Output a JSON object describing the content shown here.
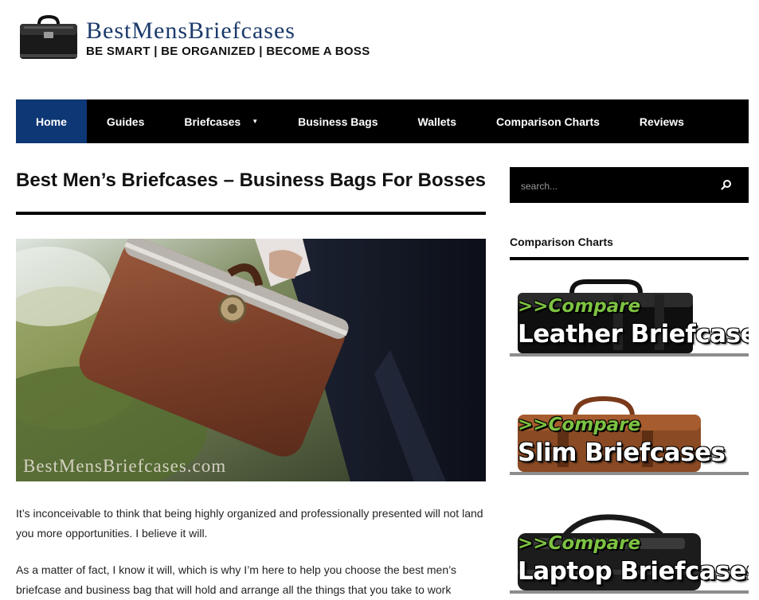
{
  "site": {
    "title": "BestMensBriefcases",
    "tagline": "BE SMART | BE ORGANIZED | BECOME A BOSS"
  },
  "nav": {
    "items": [
      {
        "label": "Home",
        "active": true
      },
      {
        "label": "Guides"
      },
      {
        "label": "Briefcases",
        "has_submenu": true
      },
      {
        "label": "Business Bags"
      },
      {
        "label": "Wallets"
      },
      {
        "label": "Comparison Charts"
      },
      {
        "label": "Reviews"
      }
    ]
  },
  "post": {
    "title": "Best Men’s Briefcases – Business Bags For Bosses",
    "hero_watermark": "BestMensBriefcases.com",
    "paragraphs": [
      "It’s inconceivable to think that being highly organized and professionally presented will not land you more opportunities. I believe it will.",
      "As a matter of fact, I know it will, which is why I’m here to help you choose the best men’s briefcase and business bag that will hold and arrange all the things that you take to work"
    ]
  },
  "sidebar": {
    "search_placeholder": "search...",
    "heading": "Comparison Charts",
    "banners": [
      {
        "compare": ">>Compare",
        "name": "Leather Briefcases"
      },
      {
        "compare": ">>Compare",
        "name": "Slim Briefcases"
      },
      {
        "compare": ">>Compare",
        "name": "Laptop Briefcases"
      }
    ]
  },
  "colors": {
    "nav_bg": "#000000",
    "nav_active": "#0e3775",
    "logo_blue": "#1b3a6b",
    "compare_green": "#7dc242"
  }
}
